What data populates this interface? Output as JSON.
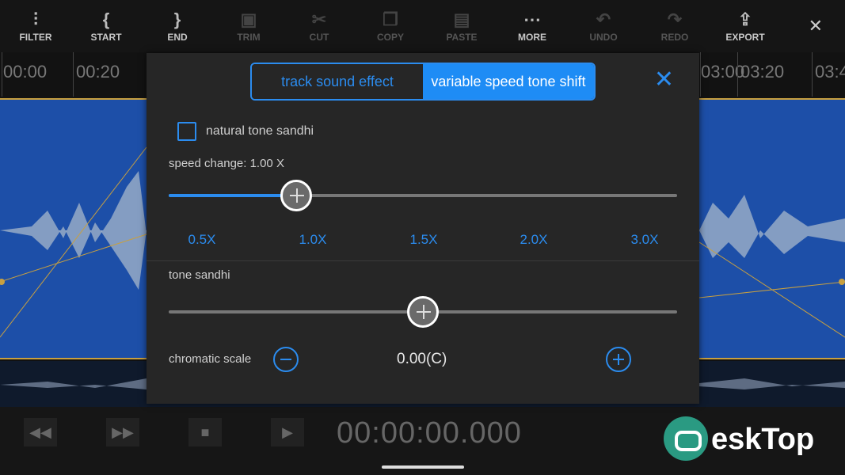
{
  "toolbar": {
    "items": [
      {
        "label": "FILTER",
        "icon": "sliders-icon",
        "glyph": "⫶"
      },
      {
        "label": "START",
        "icon": "bracket-left-icon",
        "glyph": "{"
      },
      {
        "label": "END",
        "icon": "bracket-right-icon",
        "glyph": "}"
      },
      {
        "label": "TRIM",
        "icon": "trim-icon",
        "glyph": "▣"
      },
      {
        "label": "CUT",
        "icon": "scissors-icon",
        "glyph": "✂"
      },
      {
        "label": "COPY",
        "icon": "copy-icon",
        "glyph": "❐"
      },
      {
        "label": "PASTE",
        "icon": "paste-icon",
        "glyph": "▤"
      },
      {
        "label": "MORE",
        "icon": "more-icon",
        "glyph": "⋯"
      },
      {
        "label": "UNDO",
        "icon": "undo-icon",
        "glyph": "↶"
      },
      {
        "label": "REDO",
        "icon": "redo-icon",
        "glyph": "↷"
      },
      {
        "label": "EXPORT",
        "icon": "export-icon",
        "glyph": "⇪"
      }
    ],
    "close_glyph": "✕"
  },
  "ruler": {
    "labels": [
      "00:00",
      "00:20",
      "03:00",
      "03:20",
      "03:4"
    ]
  },
  "dialog": {
    "tab_inactive": "track sound effect",
    "tab_active": "variable speed tone shift",
    "close_glyph": "✕",
    "natural_tone_label": "natural tone sandhi",
    "natural_tone_checked": false,
    "speed_label": "speed change: 1.00 X",
    "speed_ticks": [
      "0.5X",
      "1.0X",
      "1.5X",
      "2.0X",
      "3.0X"
    ],
    "speed_fraction": 0.25,
    "tone_label": "tone sandhi",
    "tone_fraction": 0.5,
    "chromatic_label": "chromatic scale",
    "chromatic_value": "0.00(C)"
  },
  "transport": {
    "timecode": "00:00:00.000",
    "rewind_glyph": "◀◀",
    "forward_glyph": "▶▶",
    "stop_glyph": "■",
    "play_glyph": "▶"
  },
  "watermark": {
    "text": "eskTop"
  },
  "colors": {
    "accent": "#2b8cef",
    "waveform": "#1d4fa8",
    "dialog_bg": "#262626"
  }
}
